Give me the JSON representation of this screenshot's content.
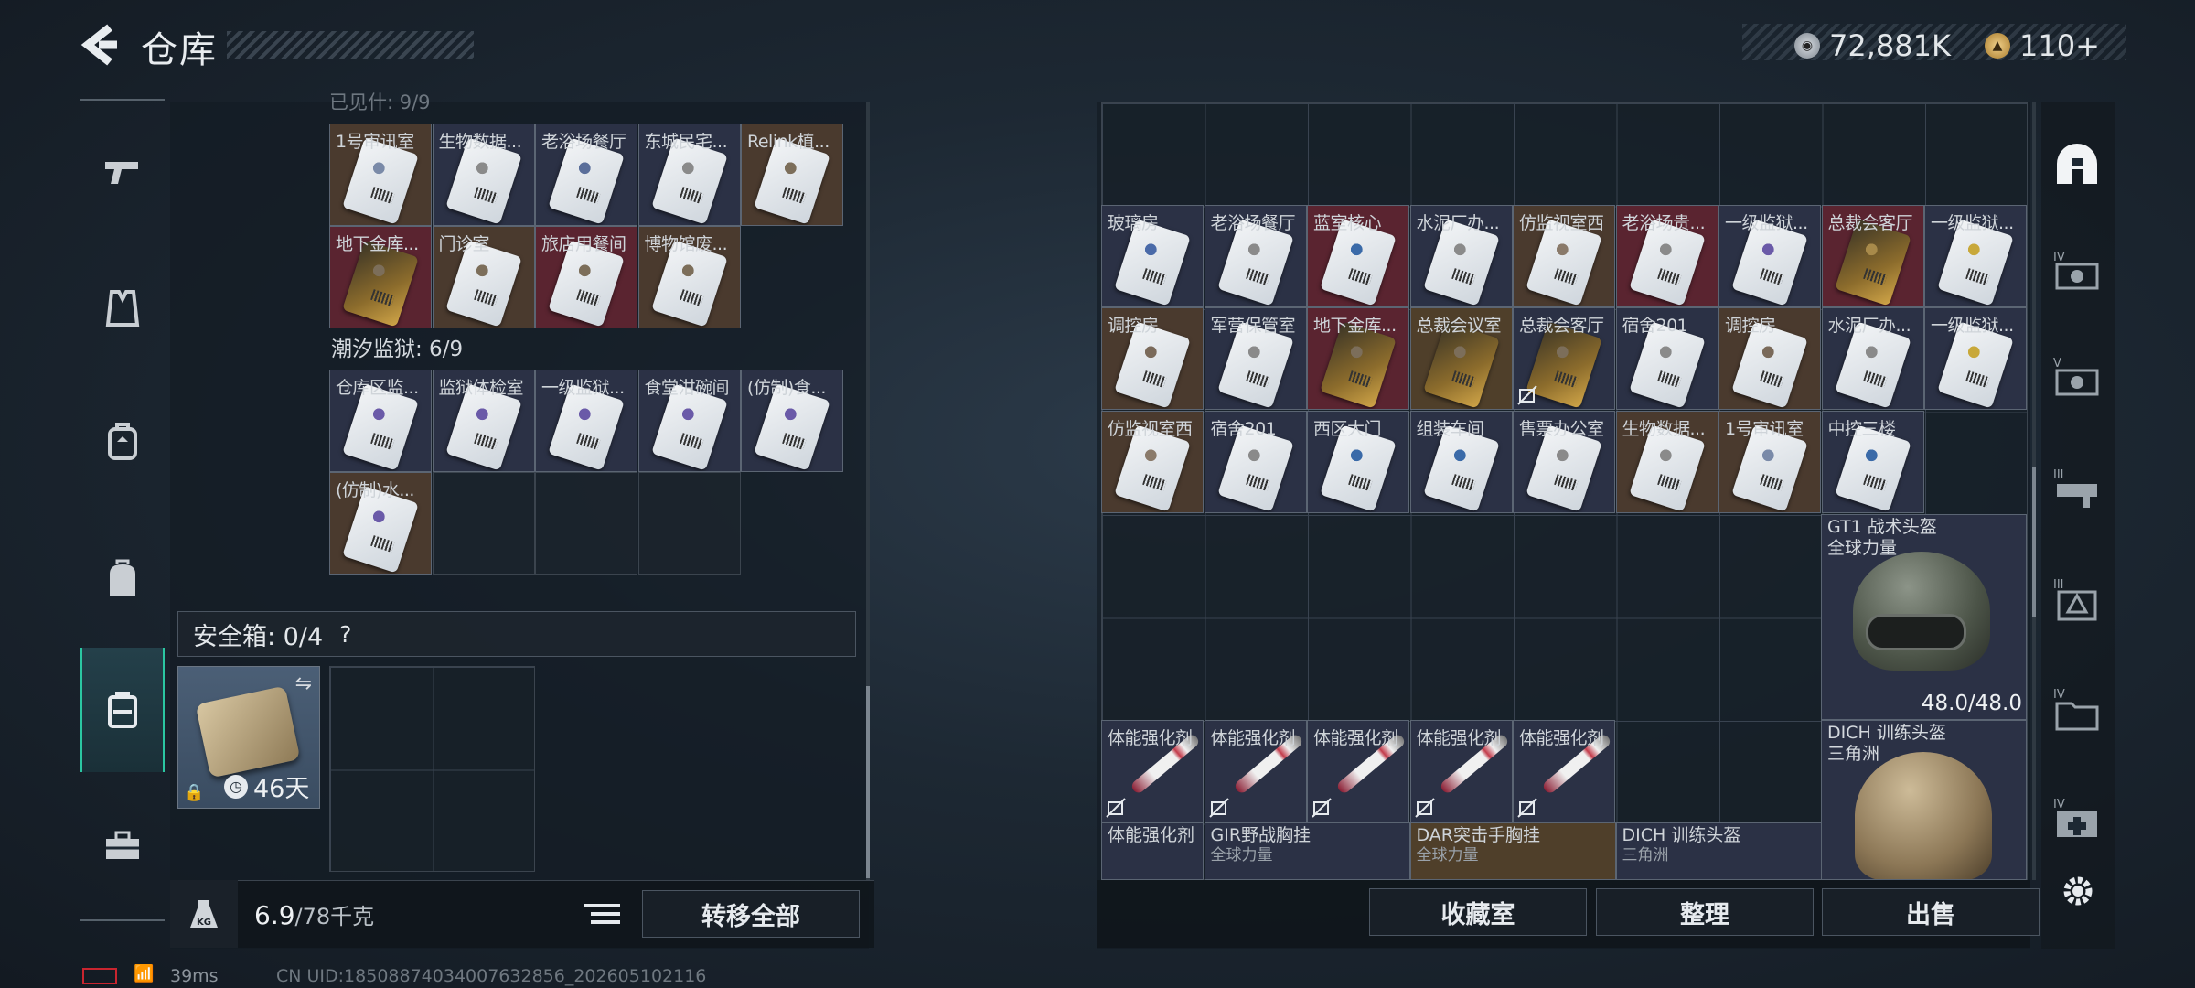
{
  "header": {
    "title": "仓库",
    "back_icon": "back-arrow-icon"
  },
  "currency": {
    "silver_value": "72,881K",
    "gold_value": "110+",
    "silver_icon": "silver-coin-icon",
    "gold_icon": "gold-coin-icon"
  },
  "left_nav": [
    {
      "icon": "gun-icon"
    },
    {
      "icon": "vest-icon"
    },
    {
      "icon": "backpack-icon"
    },
    {
      "icon": "bag-icon"
    },
    {
      "icon": "container-icon",
      "active": true
    },
    {
      "icon": "toolbox-icon"
    }
  ],
  "left_panel": {
    "section1_row1": [
      "1号审讯室",
      "生物数据...",
      "老浴场餐厅",
      "东城民宅...",
      "Relink植..."
    ],
    "section1_row2": [
      "地下金库...",
      "门诊室",
      "旅店用餐间",
      "博物馆废..."
    ],
    "section2_title": "潮汐监狱: 6/9",
    "section2_row1": [
      "仓库区监...",
      "监狱体检室",
      "一级监狱...",
      "食堂泔碗间",
      "(仿制)食..."
    ],
    "section2_row2": [
      "(仿制)水..."
    ],
    "safebox": {
      "title": "安全箱: 0/4",
      "help": "?",
      "days": "46天"
    },
    "weight": {
      "current": "6.9",
      "max": "/78千克",
      "weight_icon": "KG"
    },
    "transfer_label": "转移全部"
  },
  "right_panel": {
    "row1": [
      "玻璃房",
      "老浴场餐厅",
      "蓝室核心",
      "水泥厂办...",
      "仿监视室西",
      "老浴场贵...",
      "一级监狱...",
      "总裁会客厅",
      "一级监狱..."
    ],
    "row2": [
      "调控房",
      "军营保管室",
      "地下金库...",
      "总裁会议室",
      "总裁会客厅",
      "宿舍201",
      "调控房",
      "水泥厂办...",
      "一级监狱..."
    ],
    "row3": [
      "仿监视室西",
      "宿舍201",
      "西区大门",
      "组装车间",
      "售票办公室",
      "生物数据...",
      "1号审讯室",
      "中控三楼"
    ],
    "helmet1": {
      "name": "GT1 战术头盔",
      "brand": "全球力量",
      "durability": "48.0/48.0"
    },
    "helmet2": {
      "name": "DICH 训练头盔",
      "brand": "三角洲"
    },
    "stims": [
      "体能强化剂",
      "体能强化剂",
      "体能强化剂",
      "体能强化剂",
      "体能强化剂"
    ],
    "bottom_row": [
      {
        "name": "体能强化剂",
        "brand": ""
      },
      {
        "name": "GIR野战胸挂",
        "brand": "全球力量"
      },
      {
        "name": "DAR突击手胸挂",
        "brand": "全球力量"
      },
      {
        "name": "DICH 训练头盔",
        "brand": "三角洲"
      }
    ],
    "buttons": {
      "collection": "收藏室",
      "organize": "整理",
      "sell": "出售"
    }
  },
  "right_nav": [
    {
      "icon": "shelter-icon"
    },
    {
      "icon": "tier4-ammo-icon",
      "tier": "IV"
    },
    {
      "icon": "tier5-ammo-icon",
      "tier": "V"
    },
    {
      "icon": "tier3-weapon-icon",
      "tier": "III"
    },
    {
      "icon": "tier3-armor-icon",
      "tier": "III"
    },
    {
      "icon": "tier4-folder-icon",
      "tier": "IV"
    },
    {
      "icon": "tier4-medic-icon",
      "tier": "IV"
    },
    {
      "icon": "settings-gear-icon"
    }
  ],
  "footer": {
    "ping": "39ms",
    "uid": "CN UID:18508874034007632856_202605102116"
  }
}
